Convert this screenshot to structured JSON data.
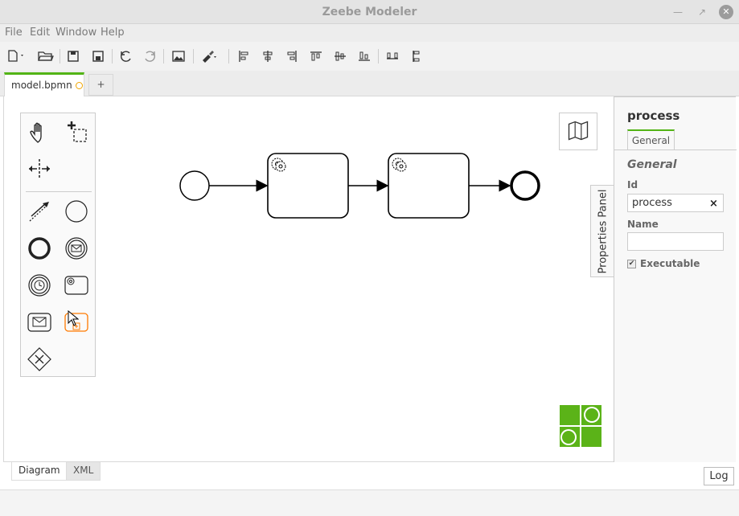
{
  "window": {
    "title": "Zeebe Modeler",
    "minimize_icon": "minimize-icon",
    "restore_icon": "restore-icon",
    "close_icon": "close-icon"
  },
  "menu": [
    "File",
    "Edit",
    "Window",
    "Help"
  ],
  "toolbar": {
    "icons": [
      "new-file-icon",
      "open-folder-icon",
      "save-icon",
      "save-as-icon",
      "undo-icon",
      "redo-icon",
      "export-image-icon",
      "color-brush-icon",
      "align-left-icon",
      "align-center-icon",
      "align-right-icon",
      "align-top-icon",
      "align-middle-icon",
      "align-bottom-icon",
      "distribute-horizontal-icon",
      "distribute-vertical-icon"
    ]
  },
  "tabs": {
    "active_label": "model.bpmn",
    "add_label": "+"
  },
  "palette": {
    "tools": [
      "hand-tool-icon",
      "lasso-tool-icon",
      "space-tool-icon",
      "global-connect-icon",
      "start-event-icon",
      "end-event-icon",
      "message-intermediate-event-icon",
      "timer-event-icon",
      "service-task-icon",
      "receive-task-icon",
      "subprocess-icon",
      "exclusive-gateway-icon"
    ]
  },
  "properties": {
    "toggle_label": "Properties Panel",
    "title": "process",
    "tab_general": "General",
    "group_title": "General",
    "id_label": "Id",
    "id_value": "process",
    "clear_symbol": "×",
    "name_label": "Name",
    "name_value": "",
    "executable_label": "Executable",
    "executable_checked": true
  },
  "bottom": {
    "tab_diagram": "Diagram",
    "tab_xml": "XML",
    "log_label": "Log"
  },
  "colors": {
    "accent": "#52b415",
    "dirty_indicator": "#f0a500",
    "palette_highlight": "#ff7a00"
  }
}
